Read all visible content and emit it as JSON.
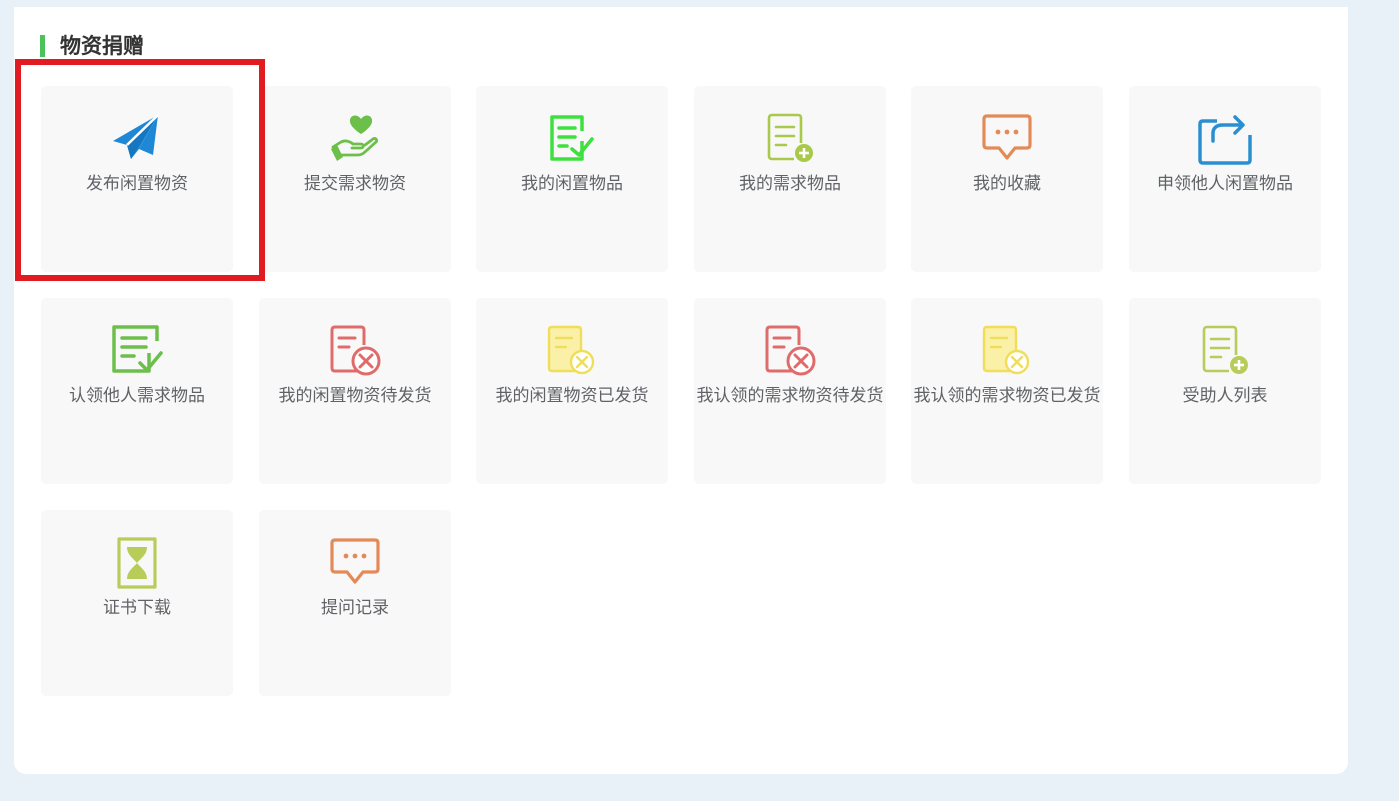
{
  "section": {
    "title": "物资捐赠"
  },
  "accent_color": "#4cc25a",
  "highlight_color": "#e01b22",
  "cards": [
    {
      "label": "发布闲置物资",
      "icon": "paper-plane-icon",
      "color": "#1e88d6"
    },
    {
      "label": "提交需求物资",
      "icon": "heart-hand-icon",
      "color": "#6cc04a"
    },
    {
      "label": "我的闲置物品",
      "icon": "document-check-icon",
      "color": "#3ee03e"
    },
    {
      "label": "我的需求物品",
      "icon": "document-add-icon",
      "color": "#a8c94a"
    },
    {
      "label": "我的收藏",
      "icon": "chat-bubble-icon",
      "color": "#e38a57"
    },
    {
      "label": "申领他人闲置物品",
      "icon": "share-box-icon",
      "color": "#2a8fd0"
    },
    {
      "label": "认领他人需求物品",
      "icon": "document-check-icon",
      "color": "#6cbf4a"
    },
    {
      "label": "我的闲置物资待发货",
      "icon": "document-cancel-icon",
      "color": "#e06b6b"
    },
    {
      "label": "我的闲置物资已发货",
      "icon": "document-cancel-icon",
      "color": "#f0de5a"
    },
    {
      "label": "我认领的需求物资待发货",
      "icon": "document-cancel-icon",
      "color": "#e06b6b"
    },
    {
      "label": "我认领的需求物资已发货",
      "icon": "document-cancel-icon",
      "color": "#f0de5a"
    },
    {
      "label": "受助人列表",
      "icon": "document-add-icon",
      "color": "#b8cc5a"
    },
    {
      "label": "证书下载",
      "icon": "hourglass-icon",
      "color": "#b8cc5a"
    },
    {
      "label": "提问记录",
      "icon": "chat-bubble-icon",
      "color": "#e38a57"
    }
  ]
}
